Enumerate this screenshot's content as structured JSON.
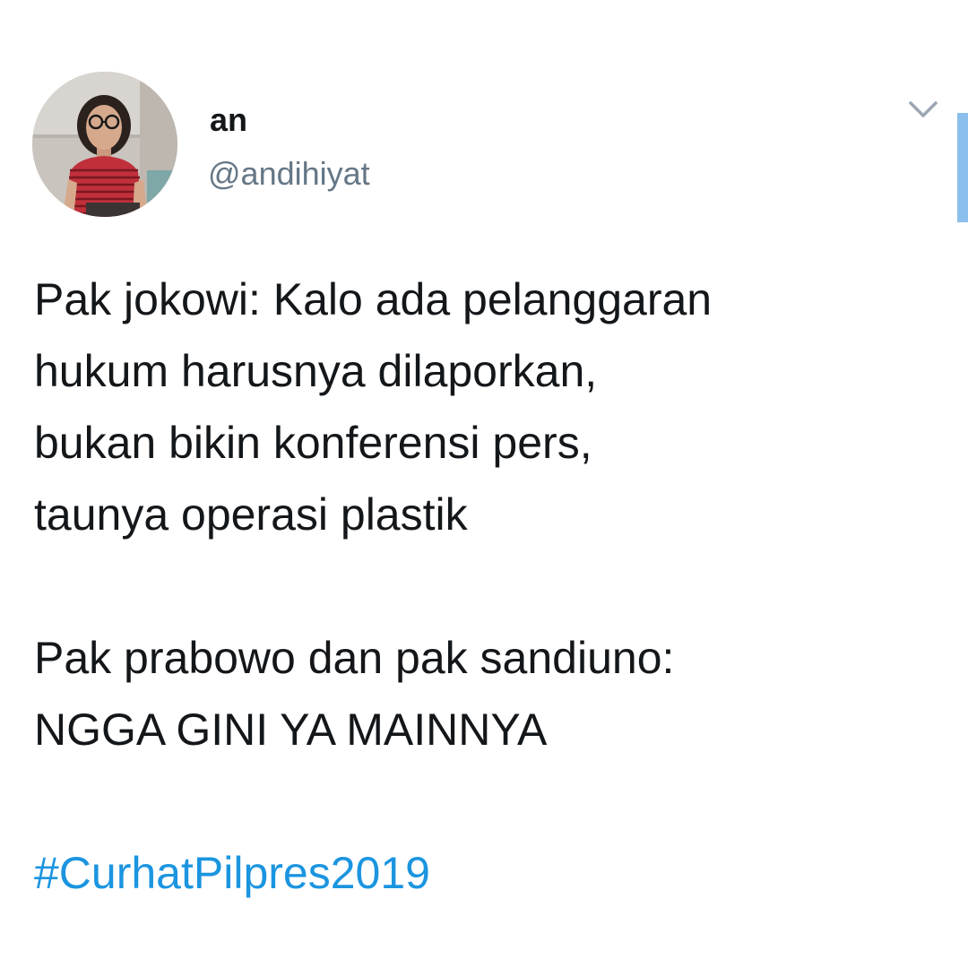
{
  "user": {
    "display_name": "an",
    "handle": "@andihiyat"
  },
  "tweet": {
    "paragraph_1": [
      "Pak jokowi: Kalo ada pelanggaran",
      "hukum harusnya dilaporkan,",
      "bukan bikin konferensi pers,",
      "taunya operasi plastik"
    ],
    "paragraph_2": [
      "Pak prabowo dan pak sandiuno:",
      "NGGA GINI YA MAINNYA"
    ],
    "hashtag": "#CurhatPilpres2019"
  },
  "icons": {
    "menu_caret": "chevron-down-icon"
  },
  "colors": {
    "text": "#14171a",
    "secondary_text": "#657786",
    "link": "#1b95e0",
    "scroll_thumb": "#8cc0ec"
  }
}
